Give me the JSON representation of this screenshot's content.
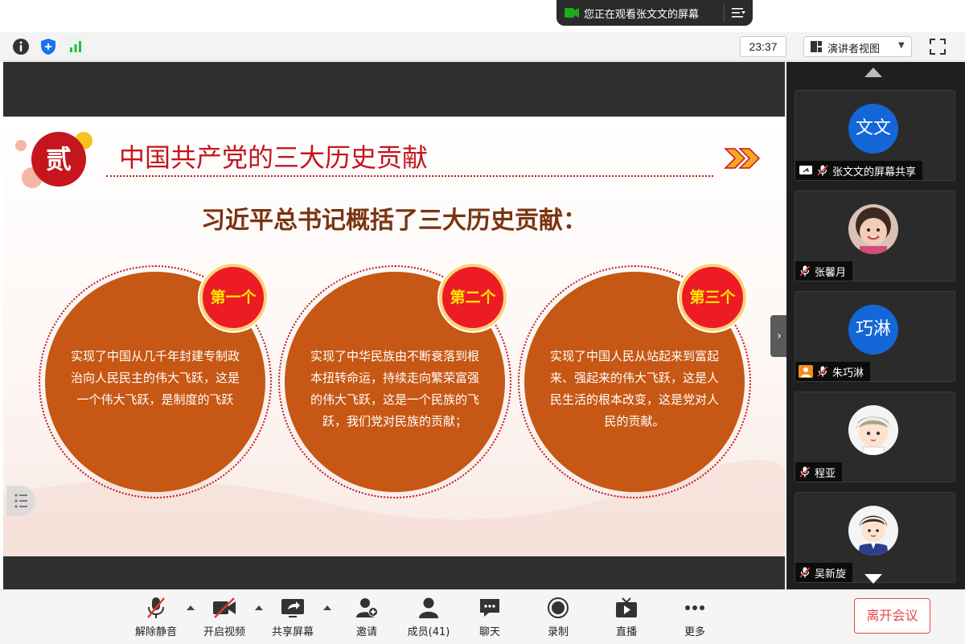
{
  "banner": {
    "viewing_text": "您正在观看张文文的屏幕"
  },
  "toolbar": {
    "timer": "23:37",
    "view_mode": "演讲者视图"
  },
  "slide": {
    "badge": "贰",
    "title": "中国共产党的三大历史贡献",
    "headline": "习近平总书记概括了三大历史贡献：",
    "contributions": [
      {
        "label": "第一个",
        "text": "实现了中国从几千年封建专制政治向人民民主的伟大飞跃，这是一个伟大飞跃，是制度的飞跃"
      },
      {
        "label": "第二个",
        "text": "实现了中华民族由不断衰落到根本扭转命运，持续走向繁荣富强的伟大飞跃，这是一个民族的飞跃，我们党对民族的贡献；"
      },
      {
        "label": "第三个",
        "text": "实现了中国人民从站起来到富起来、强起来的伟大飞跃，这是人民生活的根本改变，这是党对人民的贡献。"
      }
    ]
  },
  "participants": [
    {
      "name": "张文文的屏幕共享",
      "avatar_text": "文文",
      "avatar": "text",
      "sharing": true
    },
    {
      "name": "张馨月",
      "avatar": "photo-girl"
    },
    {
      "name": "朱巧淋",
      "avatar_text": "巧淋",
      "avatar": "text",
      "host": true
    },
    {
      "name": "程亚",
      "avatar": "cartoon-boy"
    },
    {
      "name": "吴新旋",
      "avatar": "cartoon-man"
    }
  ],
  "controls": {
    "unmute": "解除静音",
    "start_video": "开启视频",
    "share_screen": "共享屏幕",
    "invite": "邀请",
    "members": "成员(41)",
    "chat": "聊天",
    "record": "录制",
    "live": "直播",
    "more": "更多",
    "leave": "离开会议"
  },
  "colors": {
    "slide_red": "#c4161c",
    "disc_orange": "#c75714",
    "badge_red": "#ed1c24",
    "badge_text": "#ffe700",
    "leave_red": "#e64747",
    "avatar_blue": "#1367d6"
  }
}
